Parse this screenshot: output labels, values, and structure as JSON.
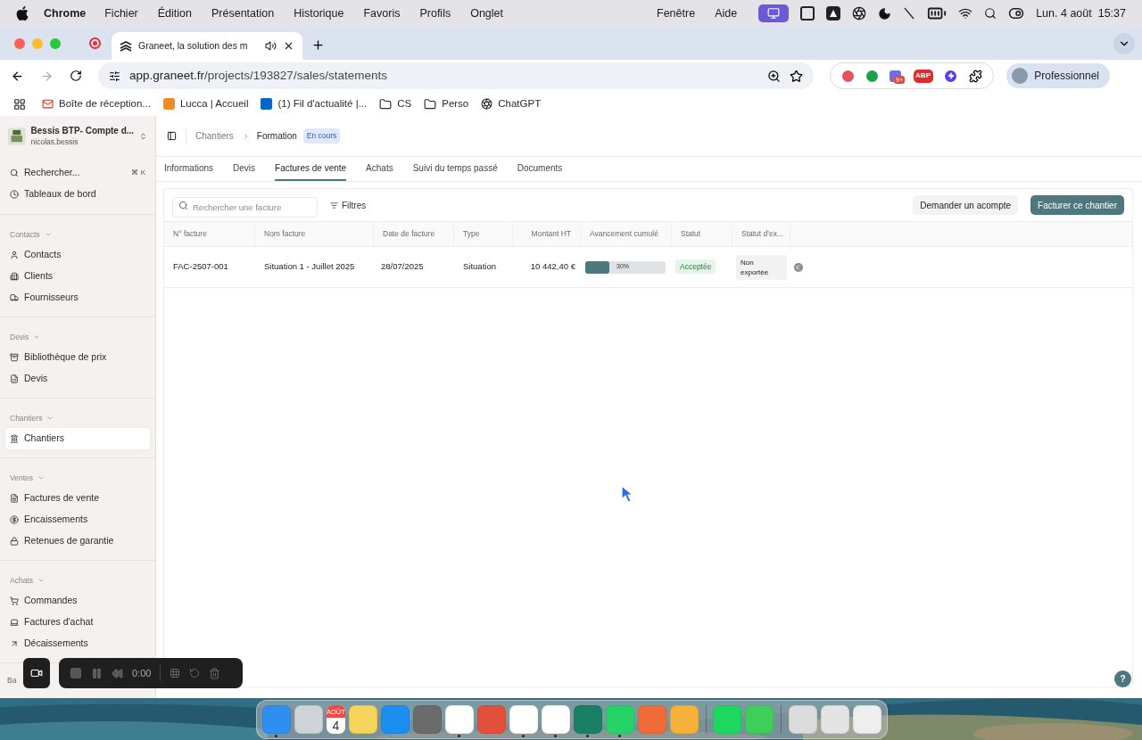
{
  "menu_bar": {
    "app": "Chrome",
    "menus": [
      "Fichier",
      "Édition",
      "Présentation",
      "Historique",
      "Favoris",
      "Profils",
      "Onglet"
    ],
    "right_menus": [
      "Fenêtre",
      "Aide"
    ],
    "date": "Lun. 4 août",
    "time": "15:37"
  },
  "browser": {
    "tab_title": "Graneet, la solution des m",
    "url_host": "app.graneet.fr",
    "url_path": "/projects/193827/sales/statements",
    "extension_badge": "9+",
    "extension_label": "ABP",
    "profile": "Professionnel",
    "bookmarks": [
      "Boîte de réception...",
      "Lucca | Accueil",
      "(1) Fil d'actualité |...",
      "CS",
      "Perso",
      "ChatGPT"
    ]
  },
  "sidebar": {
    "company": "Bessis BTP- Compte d...",
    "user": "nicolas.bessis",
    "top_items": [
      {
        "label": "Rechercher...",
        "shortcut": "⌘ K"
      },
      {
        "label": "Tableaux de bord"
      }
    ],
    "sections": [
      {
        "title": "Contacts",
        "expanded": true,
        "items": [
          {
            "label": "Contacts",
            "selected": false
          },
          {
            "label": "Clients",
            "selected": false
          },
          {
            "label": "Fournisseurs",
            "selected": false
          }
        ]
      },
      {
        "title": "Devis",
        "expanded": true,
        "items": [
          {
            "label": "Bibliothèque de prix",
            "selected": false
          },
          {
            "label": "Devis",
            "selected": false
          }
        ]
      },
      {
        "title": "Chantiers",
        "expanded": true,
        "items": [
          {
            "label": "Chantiers",
            "selected": true
          }
        ]
      },
      {
        "title": "Ventes",
        "expanded": true,
        "items": [
          {
            "label": "Factures de vente",
            "selected": false
          },
          {
            "label": "Encaissements",
            "selected": false
          },
          {
            "label": "Retenues de garantie",
            "selected": false
          }
        ]
      },
      {
        "title": "Achats",
        "expanded": true,
        "items": [
          {
            "label": "Commandes",
            "selected": false
          },
          {
            "label": "Factures d'achat",
            "selected": false
          },
          {
            "label": "Décaissements",
            "selected": false
          }
        ]
      }
    ],
    "cut_section": "Ba"
  },
  "page": {
    "breadcrumb": [
      "Chantiers",
      "Formation"
    ],
    "badge": "En cours",
    "tabs": [
      {
        "label": "Informations",
        "selected": false
      },
      {
        "label": "Devis",
        "selected": false
      },
      {
        "label": "Factures de vente",
        "selected": true
      },
      {
        "label": "Achats",
        "selected": false
      },
      {
        "label": "Suivi du temps passé",
        "selected": false
      },
      {
        "label": "Documents",
        "selected": false
      }
    ],
    "search": {
      "placeholder": "Rechercher une facture"
    },
    "filters": "Filtres",
    "buttons": [
      {
        "label": "Demander un acompte",
        "kind": "secondary"
      },
      {
        "label": "Facturer ce chantier",
        "kind": "primary"
      }
    ],
    "table": {
      "columns": [
        "N° facture",
        "Nom facture",
        "Date de facture",
        "Type",
        "Montant HT",
        "Avancement cumulé",
        "Statut",
        "Statut d'ex..."
      ],
      "rows": [
        {
          "number": "FAC-2507-001",
          "name": "Situation 1 - Juillet 2025",
          "date": "28/07/2025",
          "type": "Situation",
          "amount": "10 442,40 €",
          "level": 0.3,
          "progress": "30%",
          "status": "Acceptée",
          "export": "Non exportée"
        }
      ]
    }
  },
  "help": "?",
  "recorder": {
    "time": "0:00"
  },
  "dock": {
    "calendar_month": "AOÛT",
    "calendar_day": "4"
  }
}
